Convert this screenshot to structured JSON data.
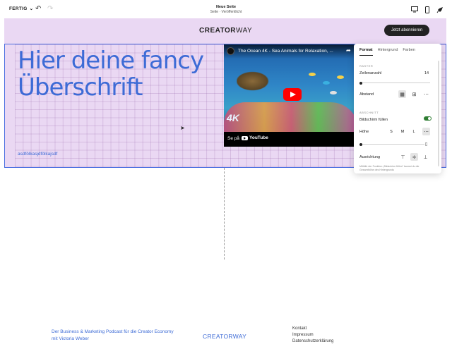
{
  "editor": {
    "done_label": "FERTIG",
    "undo_icon": "↶",
    "redo_icon": "↷",
    "page_name": "Neue Seite",
    "page_status": "Seite · Veröffentlicht"
  },
  "site": {
    "logo_main": "CREATOR",
    "logo_tail": "WAY",
    "subscribe_label": "Jetzt abonnieren",
    "hero_title": "Hier deine fancy Überschrift",
    "hero_sub": "asdfölkasjdfölkajsdf",
    "colors": {
      "accent": "#3d6bd6",
      "background": "#ead8f3",
      "selection": "#4b6ee0"
    }
  },
  "video": {
    "title": "The Ocean 4K - Sea Animals for Relaxation, ...",
    "watch_on": "Se på",
    "youtube": "YouTube",
    "badge": "4K"
  },
  "panel": {
    "tabs": [
      "Format",
      "Hintergrund",
      "Farben"
    ],
    "raster_label": "RASTER",
    "rows_label": "Zeilenanzahl",
    "rows_value": "14",
    "spacing_label": "Abstand",
    "section_label": "ABSCHNITT",
    "fill_label": "Bildschirm füllen",
    "height_label": "Höhe",
    "sizes": [
      "S",
      "M",
      "L"
    ],
    "alignment_label": "Ausrichtung",
    "hint": "Mithilfe der Funktion „Bildschirm füllen\" kannst du die Gesamthöhe des Hintergrunds"
  },
  "footer": {
    "text": "Der Business & Marketing Podcast für die Creator Economy mit Victoria Weber",
    "logo_main": "CREATOR",
    "logo_tail": "WAY",
    "links": [
      "Kontakt",
      "Impressum",
      "Datenschutzerklärung"
    ]
  }
}
